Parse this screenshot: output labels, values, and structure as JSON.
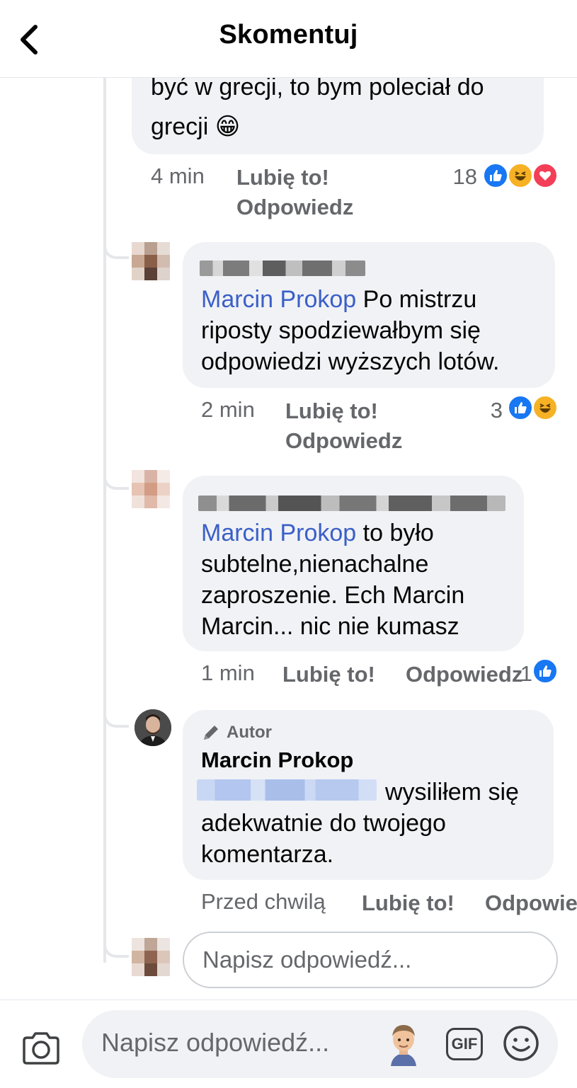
{
  "header": {
    "title": "Skomentuj"
  },
  "comments": [
    {
      "text_line1": "być w grecji, to bym poleciał do",
      "text_line2": "grecji",
      "emoji": "😁",
      "time": "4 min",
      "like_label": "Lubię to!",
      "reply_label": "Odpowiedz",
      "reaction_count": "18",
      "reactions": [
        "like-icon",
        "haha-icon",
        "love-icon"
      ]
    },
    {
      "mention": "Marcin Prokop",
      "text_line1": " Po mistrzu",
      "text_line2": "riposty spodziewałbym się",
      "text_line3": "odpowiedzi wyższych lotów.",
      "time": "2 min",
      "like_label": "Lubię to!",
      "reply_label": "Odpowiedz",
      "reaction_count": "3",
      "reactions": [
        "like-icon",
        "haha-icon"
      ]
    },
    {
      "mention": "Marcin Prokop",
      "text_line1": " to było",
      "text_line2": "subtelne,nienachalne",
      "text_line3": "zaproszenie. Ech Marcin",
      "text_line4": "Marcin... nic nie kumasz",
      "time": "1 min",
      "like_label": "Lubię to!",
      "reply_label": "Odpowiedz",
      "reaction_count": "1",
      "reactions": [
        "like-icon"
      ]
    },
    {
      "badge": "Autor",
      "author": "Marcin Prokop",
      "text_line1": "wysiliłem się",
      "text_line2": "adekwatnie do twojego",
      "text_line3": "komentarza.",
      "time": "Przed chwilą",
      "like_label": "Lubię to!",
      "reply_label": "Odpowie"
    }
  ],
  "reply_box": {
    "placeholder": "Napisz odpowiedź..."
  },
  "composer": {
    "placeholder": "Napisz odpowiedź...",
    "gif_label": "GIF"
  },
  "colors": {
    "mention": "#3b5fc8",
    "bubble": "#f0f2f5",
    "meta": "#65676b",
    "like": "#1877f2",
    "love": "#f33e58",
    "haha": "#f7b125"
  }
}
